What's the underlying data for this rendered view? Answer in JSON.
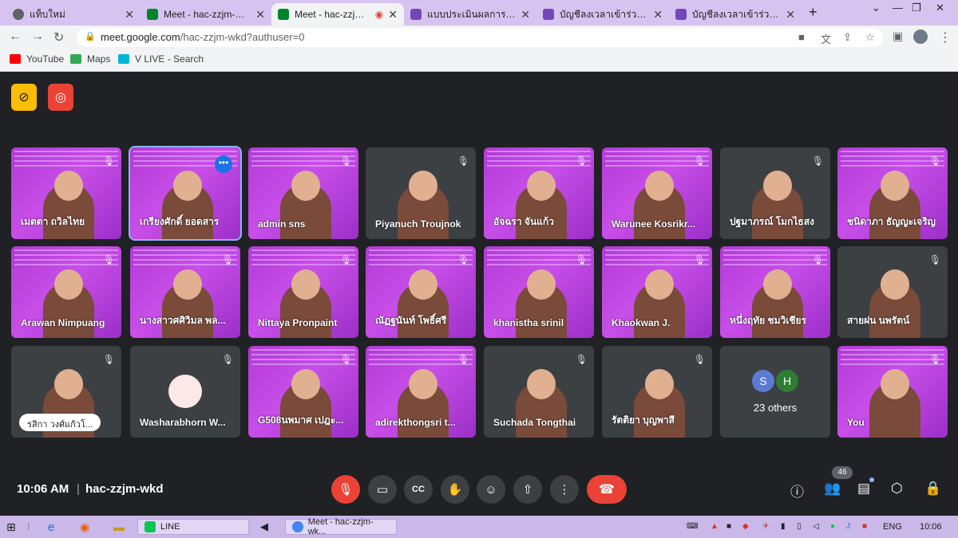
{
  "browser": {
    "tabs": [
      {
        "label": "แท็บใหม่",
        "color": "#5f6368"
      },
      {
        "label": "Meet - hac-zzjm-wkd",
        "color": "#00832d"
      },
      {
        "label": "Meet - hac-zzjm-wk",
        "color": "#00832d"
      },
      {
        "label": "แบบประเมินผลการจัดกิจกร",
        "color": "#7248b9"
      },
      {
        "label": "บัญชีลงเวลาเข้าร่วมกิจกรรม",
        "color": "#7248b9"
      },
      {
        "label": "บัญชีลงเวลาเข้าร่วมกิจกรรม",
        "color": "#7248b9"
      }
    ],
    "url_host": "meet.google.com",
    "url_path": "/hac-zzjm-wkd?authuser=0",
    "bookmarks": [
      {
        "label": "YouTube",
        "color": "#ff0000"
      },
      {
        "label": "Maps",
        "color": "#34a853"
      },
      {
        "label": "V LIVE - Search",
        "color": "#00b4d8"
      }
    ]
  },
  "meeting": {
    "time": "10:06 AM",
    "separator": "|",
    "code": "hac-zzjm-wkd",
    "participant_count": "46",
    "tiles": [
      {
        "name": "เมตตา ถวิลไทย",
        "kind": "slide"
      },
      {
        "name": "เกรียงศักดิ์ ยอดสาร",
        "kind": "slide",
        "speaking": true
      },
      {
        "name": "admin sns",
        "kind": "slide"
      },
      {
        "name": "Piyanuch Troujnok",
        "kind": "grey"
      },
      {
        "name": "อัจฉรา จันแก้ว",
        "kind": "slide"
      },
      {
        "name": "Warunee Kosrikr...",
        "kind": "slide"
      },
      {
        "name": "ปฐมาภรณ์ โมกไธสง",
        "kind": "grey"
      },
      {
        "name": "ชนิดาภา ธัญญะเจริญ",
        "kind": "slide"
      },
      {
        "name": "Arawan Nimpuang",
        "kind": "slide"
      },
      {
        "name": "นางสาวศศิวิมล พล...",
        "kind": "slide"
      },
      {
        "name": "Nittaya Pronpaint",
        "kind": "slide"
      },
      {
        "name": "ณัฏฐนันท์ โพธิ์ศรี",
        "kind": "slide"
      },
      {
        "name": "khanistha srinil",
        "kind": "slide"
      },
      {
        "name": "Khaokwan J.",
        "kind": "slide"
      },
      {
        "name": "หนึ่งฤทัย ชมวิเชียร",
        "kind": "slide"
      },
      {
        "name": "สายฝน นพรัตน์",
        "kind": "grey"
      },
      {
        "name": "รสิกา วงศ์แก้วโ...",
        "kind": "grey",
        "pill": true
      },
      {
        "name": "Washarabhorn W...",
        "kind": "grey",
        "avatar": true
      },
      {
        "name": "G508นพมาศ เปฎะ...",
        "kind": "slide"
      },
      {
        "name": "adirekthongsri t...",
        "kind": "slide"
      },
      {
        "name": "Suchada Tongthai",
        "kind": "grey"
      },
      {
        "name": "รัตติยา บุญพาสี",
        "kind": "grey"
      },
      {
        "name": "",
        "kind": "others"
      },
      {
        "name": "You",
        "kind": "slide"
      }
    ],
    "others": {
      "label": "23 others",
      "initials": [
        "S",
        "H"
      ],
      "colors": [
        "#5b7ad4",
        "#2e7d32"
      ]
    }
  },
  "taskbar": {
    "items": [
      "LINE",
      "Meet - hac-zzjm-wk..."
    ],
    "language": "ENG",
    "clock": "10:06"
  }
}
